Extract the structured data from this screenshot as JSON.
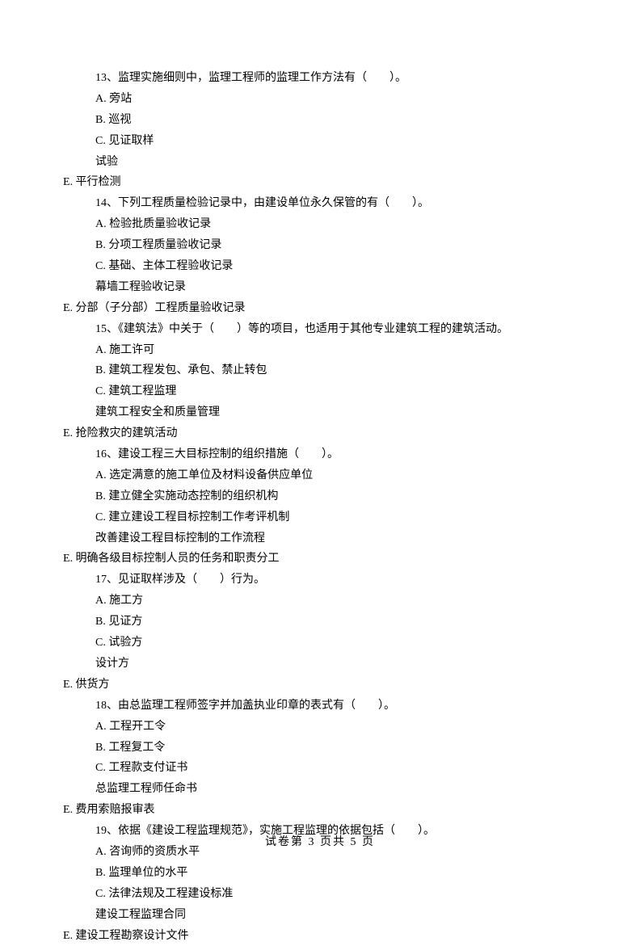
{
  "questions": [
    {
      "num": "13",
      "stem": "13、监理实施细则中，监理工程师的监理工作方法有（　　）。",
      "options": [
        "A. 旁站",
        "B. 巡视",
        "C. 见证取样",
        "试验"
      ],
      "e_option": "E. 平行检测"
    },
    {
      "num": "14",
      "stem": "14、下列工程质量检验记录中，由建设单位永久保管的有（　　）。",
      "options": [
        "A. 检验批质量验收记录",
        "B. 分项工程质量验收记录",
        "C. 基础、主体工程验收记录",
        "幕墙工程验收记录"
      ],
      "e_option": "E. 分部（子分部）工程质量验收记录"
    },
    {
      "num": "15",
      "stem": "15、《建筑法》中关于（　　）等的项目，也适用于其他专业建筑工程的建筑活动。",
      "options": [
        "A. 施工许可",
        "B. 建筑工程发包、承包、禁止转包",
        "C. 建筑工程监理",
        "建筑工程安全和质量管理"
      ],
      "e_option": "E. 抢险救灾的建筑活动"
    },
    {
      "num": "16",
      "stem": "16、建设工程三大目标控制的组织措施（　　）。",
      "options": [
        "A. 选定满意的施工单位及材料设备供应单位",
        "B. 建立健全实施动态控制的组织机构",
        "C. 建立建设工程目标控制工作考评机制",
        "改善建设工程目标控制的工作流程"
      ],
      "e_option": "E. 明确各级目标控制人员的任务和职责分工"
    },
    {
      "num": "17",
      "stem": "17、见证取样涉及（　　）行为。",
      "options": [
        "A. 施工方",
        "B. 见证方",
        "C. 试验方",
        "设计方"
      ],
      "e_option": "E. 供货方"
    },
    {
      "num": "18",
      "stem": "18、由总监理工程师签字并加盖执业印章的表式有（　　）。",
      "options": [
        "A. 工程开工令",
        "B. 工程复工令",
        "C. 工程款支付证书",
        "总监理工程师任命书"
      ],
      "e_option": "E. 费用索赔报审表"
    },
    {
      "num": "19",
      "stem": "19、依据《建设工程监理规范》，实施工程监理的依据包括（　　）。",
      "options": [
        "A. 咨询师的资质水平",
        "B. 监理单位的水平",
        "C. 法律法规及工程建设标准",
        "建设工程监理合同"
      ],
      "e_option": "E. 建设工程勘察设计文件"
    }
  ],
  "footer": "试卷第 3 页共 5 页"
}
